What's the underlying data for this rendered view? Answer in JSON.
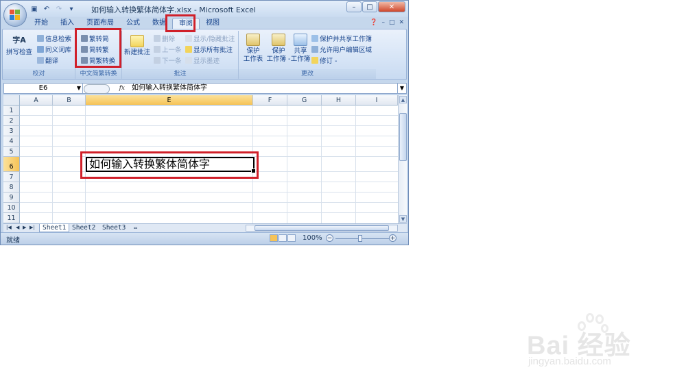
{
  "window": {
    "title": "如何输入转换繁体简体字.xlsx - Microsoft Excel",
    "controls": {
      "minimize": "–",
      "maximize": "□",
      "close": "✕"
    }
  },
  "quick_access": [
    "save-icon",
    "undo-icon",
    "redo-icon",
    "customize-icon"
  ],
  "tabs": [
    {
      "label": "开始"
    },
    {
      "label": "插入"
    },
    {
      "label": "页面布局"
    },
    {
      "label": "公式"
    },
    {
      "label": "数据"
    },
    {
      "label": "审阅",
      "active": true
    },
    {
      "label": "视图"
    }
  ],
  "ribbon": {
    "proofing": {
      "label": "校对",
      "spellcheck": "拼写检查",
      "spell_glyph": "字A",
      "research": "信息检索",
      "thesaurus": "同义词库",
      "translate": "翻译"
    },
    "chinese": {
      "label": "中文简繁转换",
      "to_simplified": "繁转简",
      "to_traditional": "简转繁",
      "convert": "简繁转换"
    },
    "comments": {
      "label": "批注",
      "new": "新建批注",
      "delete": "删除",
      "previous": "上一条",
      "next": "下一条",
      "show_hide": "显示/隐藏批注",
      "show_all": "显示所有批注",
      "show_ink": "显示墨迹"
    },
    "changes": {
      "label": "更改",
      "protect_sheet_1": "保护",
      "protect_sheet_2": "工作表",
      "protect_book_1": "保护",
      "protect_book_2": "工作簿 -",
      "share_1": "共享",
      "share_2": "工作簿",
      "protect_share": "保护并共享工作簿",
      "allow_edit": "允许用户编辑区域",
      "track": "修订 -"
    }
  },
  "formula_bar": {
    "name_box": "E6",
    "fx": "fx",
    "content": "如何输入转换繁体简体字"
  },
  "grid": {
    "columns": [
      "A",
      "B",
      "E",
      "F",
      "G",
      "H",
      "I"
    ],
    "rows": [
      "1",
      "2",
      "3",
      "4",
      "5",
      "6",
      "7",
      "8",
      "9",
      "10",
      "11"
    ],
    "selected_column": "E",
    "selected_row": "6",
    "active_cell_text": "如何输入转换繁体简体字"
  },
  "sheets": [
    "Sheet1",
    "Sheet2",
    "Sheet3"
  ],
  "status": {
    "ready": "就绪",
    "zoom": "100%"
  },
  "watermark": {
    "brand": "Bai 经验",
    "url": "jingyan.baidu.com"
  },
  "colors": {
    "highlight": "#d0202a",
    "selected_header": "#f6c357",
    "ribbon_text": "#15428b"
  }
}
